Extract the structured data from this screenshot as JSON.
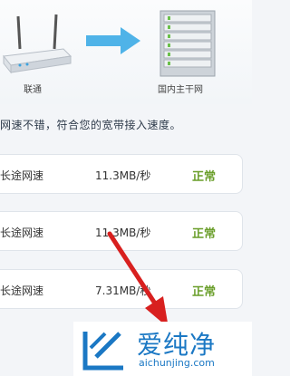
{
  "diagram": {
    "left_caption": "联通",
    "right_caption": "国内主干网"
  },
  "verdict": "网速不错，符合您的宽带接入速度。",
  "rows": [
    {
      "name": "长途网速",
      "speed": "11.3MB/秒",
      "status": "正常"
    },
    {
      "name": "长途网速",
      "speed": "11.3MB/秒",
      "status": "正常"
    },
    {
      "name": "长途网速",
      "speed": "7.31MB/秒",
      "status": "正常"
    }
  ],
  "watermark": {
    "name": "爱纯净",
    "url": "aichunjing.com"
  },
  "colors": {
    "status_green": "#6a9e2a",
    "accent_arrow": "#4fb3e8",
    "pointer_red": "#d8201f",
    "logo_blue": "#1b78c4"
  }
}
